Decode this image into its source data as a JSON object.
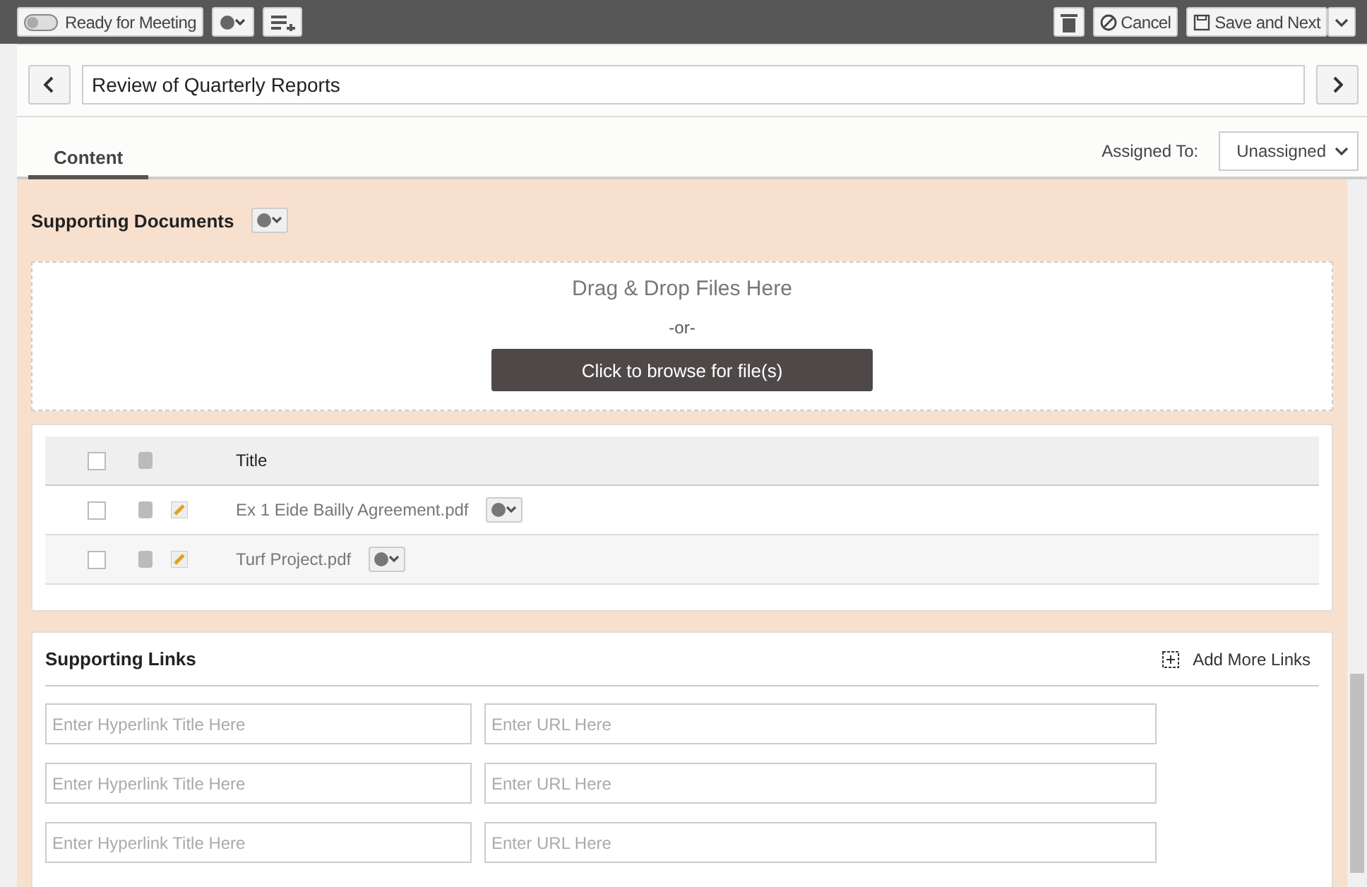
{
  "toolbar": {
    "ready_toggle": {
      "label": "Ready for Meeting",
      "on": false
    },
    "cancel": "Cancel",
    "save": "Save and Next"
  },
  "item": {
    "title": "Review of Quarterly Reports"
  },
  "tabs": [
    {
      "label": "Content",
      "selected": true
    }
  ],
  "assigned": {
    "label": "Assigned To:",
    "value": "Unassigned"
  },
  "documents": {
    "title": "Supporting Documents",
    "drop_text": "Drag & Drop Files Here",
    "or_text": "-or-",
    "browse": "Click to browse for file(s)",
    "columns": [
      "Title"
    ],
    "select_all_checked": false,
    "files": [
      {
        "name": "Ex 1 Eide Bailly Agreement.pdf",
        "checked": false
      },
      {
        "name": "Turf Project.pdf",
        "checked": false
      }
    ]
  },
  "links": {
    "title": "Supporting Links",
    "add": "Add More Links",
    "rows": [
      {
        "title_placeholder": "Enter Hyperlink Title Here",
        "url_placeholder": "Enter URL Here"
      },
      {
        "title_placeholder": "Enter Hyperlink Title Here",
        "url_placeholder": "Enter URL Here"
      },
      {
        "title_placeholder": "Enter Hyperlink Title Here",
        "url_placeholder": "Enter URL Here"
      }
    ]
  }
}
